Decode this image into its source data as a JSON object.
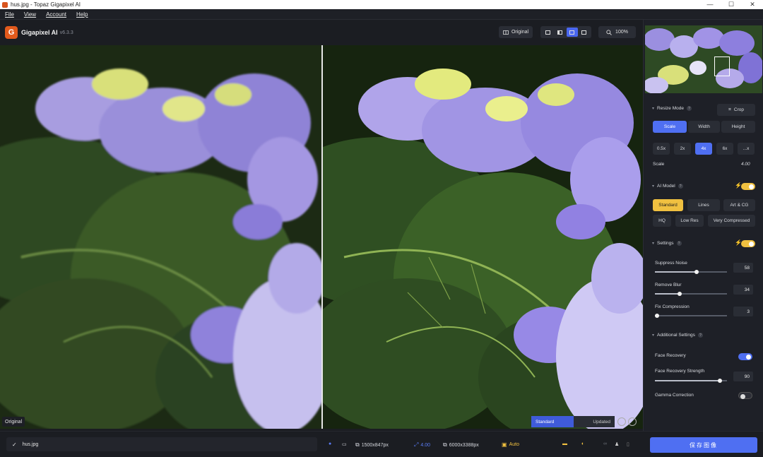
{
  "window": {
    "title": "hus.jpg - Topaz Gigapixel AI",
    "controls": {
      "minimize": "—",
      "maximize": "☐",
      "close": "✕"
    }
  },
  "menu": [
    {
      "label": "File"
    },
    {
      "label": "View"
    },
    {
      "label": "Account"
    },
    {
      "label": "Help"
    }
  ],
  "header": {
    "logo_letter": "G",
    "app_name": "Gigapixel AI",
    "version": "v6.3.3",
    "original_button": "Original",
    "zoom": "100%",
    "active_view_mode": 3
  },
  "viewer": {
    "left_label": "Original",
    "model_tag": "Standard",
    "status_tag": "Updated"
  },
  "panel": {
    "resize_mode": {
      "title": "Resize Mode",
      "crop_button": "Crop",
      "tabs": [
        "Scale",
        "Width",
        "Height"
      ],
      "active_tab": "Scale",
      "scale_options": [
        "0.5x",
        "2x",
        "4x",
        "6x",
        "...x"
      ],
      "active_scale": "4x",
      "scale_label": "Scale",
      "scale_value": "4.00"
    },
    "ai_model": {
      "title": "AI Model",
      "enabled": true,
      "models": [
        "Standard",
        "Lines",
        "Art & CG",
        "HQ",
        "Low Res",
        "Very Compressed"
      ],
      "active_model": "Standard"
    },
    "settings": {
      "title": "Settings",
      "enabled": true,
      "sliders": [
        {
          "label": "Suppress Noise",
          "value": "58",
          "fraction": 0.58
        },
        {
          "label": "Remove Blur",
          "value": "34",
          "fraction": 0.34
        },
        {
          "label": "Fix Compression",
          "value": "3",
          "fraction": 0.03
        }
      ]
    },
    "additional": {
      "title": "Additional Settings",
      "face_recovery_label": "Face Recovery",
      "face_recovery_on": true,
      "face_strength_label": "Face Recovery Strength",
      "face_strength_value": "90",
      "face_strength_fraction": 0.9,
      "gamma_label": "Gamma Correction",
      "gamma_on": false
    }
  },
  "bottom": {
    "file_name": "hus.jpg",
    "input_size": "1500x847px",
    "scale": "4.00",
    "output_size": "6000x3388px",
    "auto_label": "Auto",
    "save_label": "保存图像"
  },
  "colors": {
    "accent_blue": "#4f6ff2",
    "accent_yellow": "#f0c040",
    "logo_orange": "#e25a1c",
    "background": "#1b1d22"
  }
}
